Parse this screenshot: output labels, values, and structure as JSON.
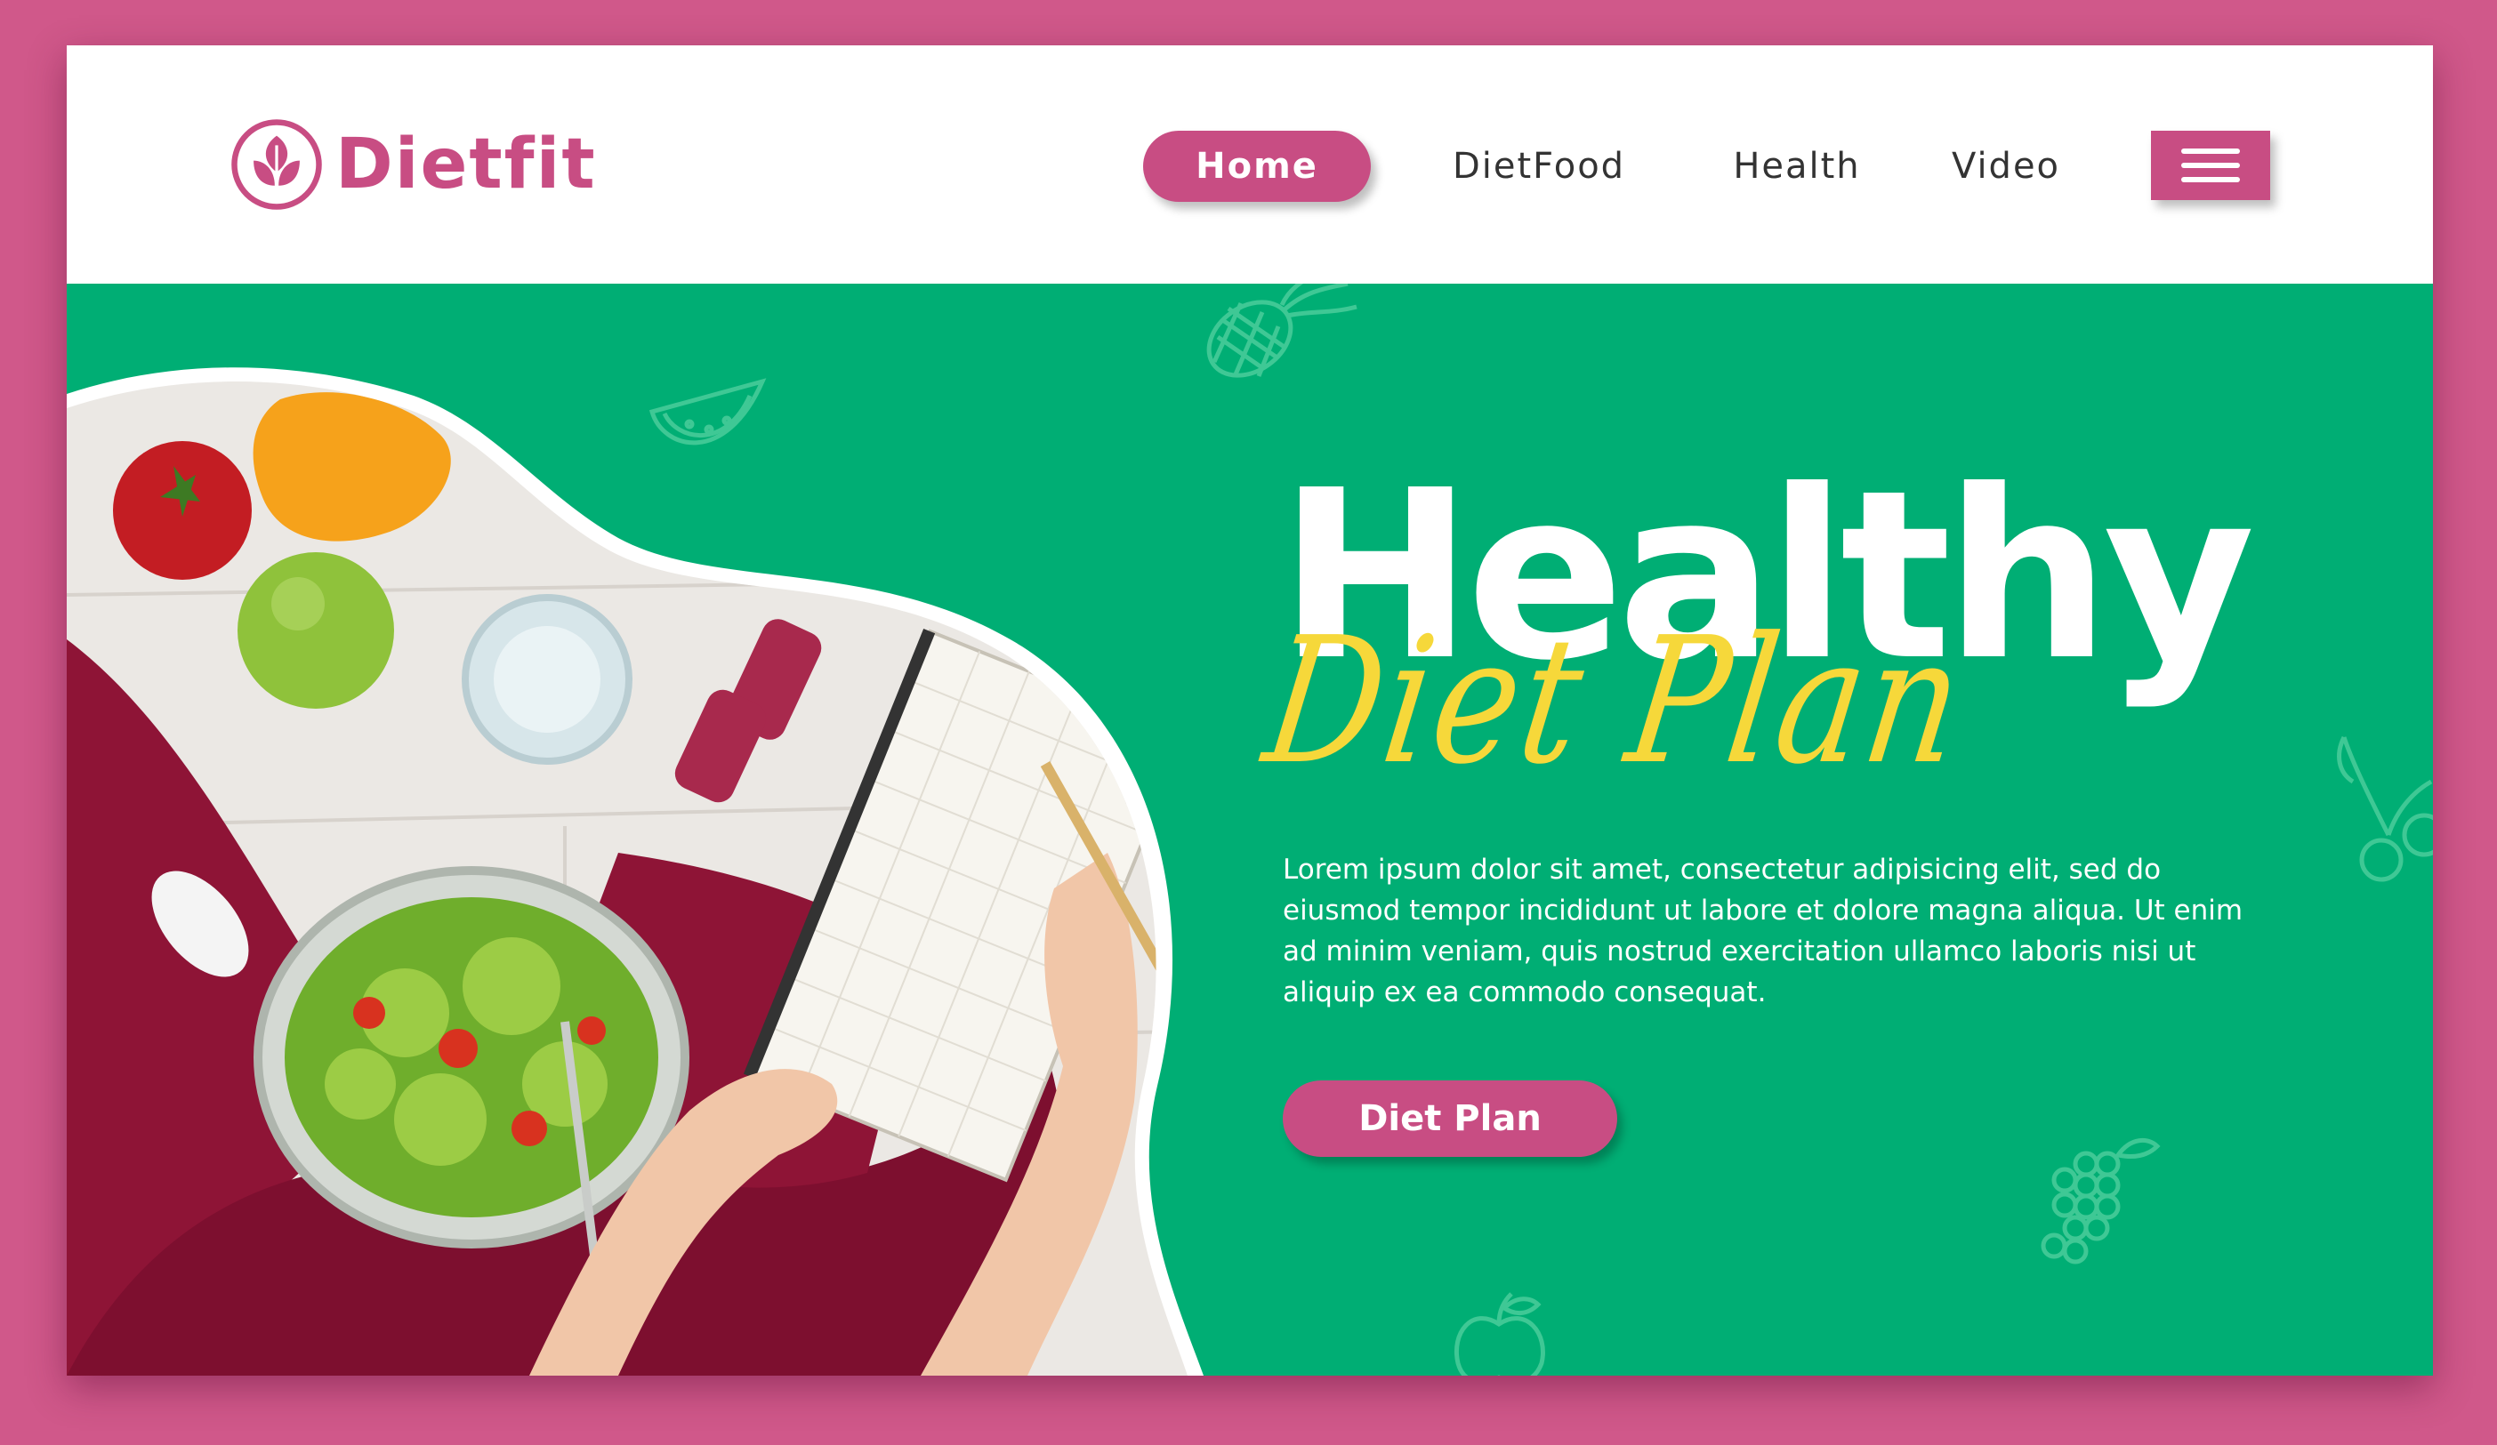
{
  "brand": {
    "name": "Dietfit",
    "logo_icon": "leaf-circle-icon",
    "color": "#c84d83"
  },
  "nav": {
    "items": [
      {
        "label": "Home",
        "active": true
      },
      {
        "label": "DietFood",
        "active": false
      },
      {
        "label": "Health",
        "active": false
      },
      {
        "label": "Video",
        "active": false
      }
    ],
    "menu_icon": "hamburger-menu-icon"
  },
  "hero": {
    "title_main": "Healthy",
    "title_script": "Diet Plan",
    "paragraph": "Lorem ipsum dolor sit amet, consectetur adipisicing elit, sed do eiusmod tempor incididunt ut labore et dolore magna aliqua. Ut enim ad minim veniam, quis nostrud exercitation ullamco laboris nisi ut aliquip ex ea commodo consequat.",
    "cta_label": "Diet Plan",
    "background_color": "#00ae74",
    "script_color": "#f6d83a"
  },
  "colors": {
    "frame": "#d0588a",
    "accent": "#c84d83",
    "hero": "#00ae74"
  }
}
